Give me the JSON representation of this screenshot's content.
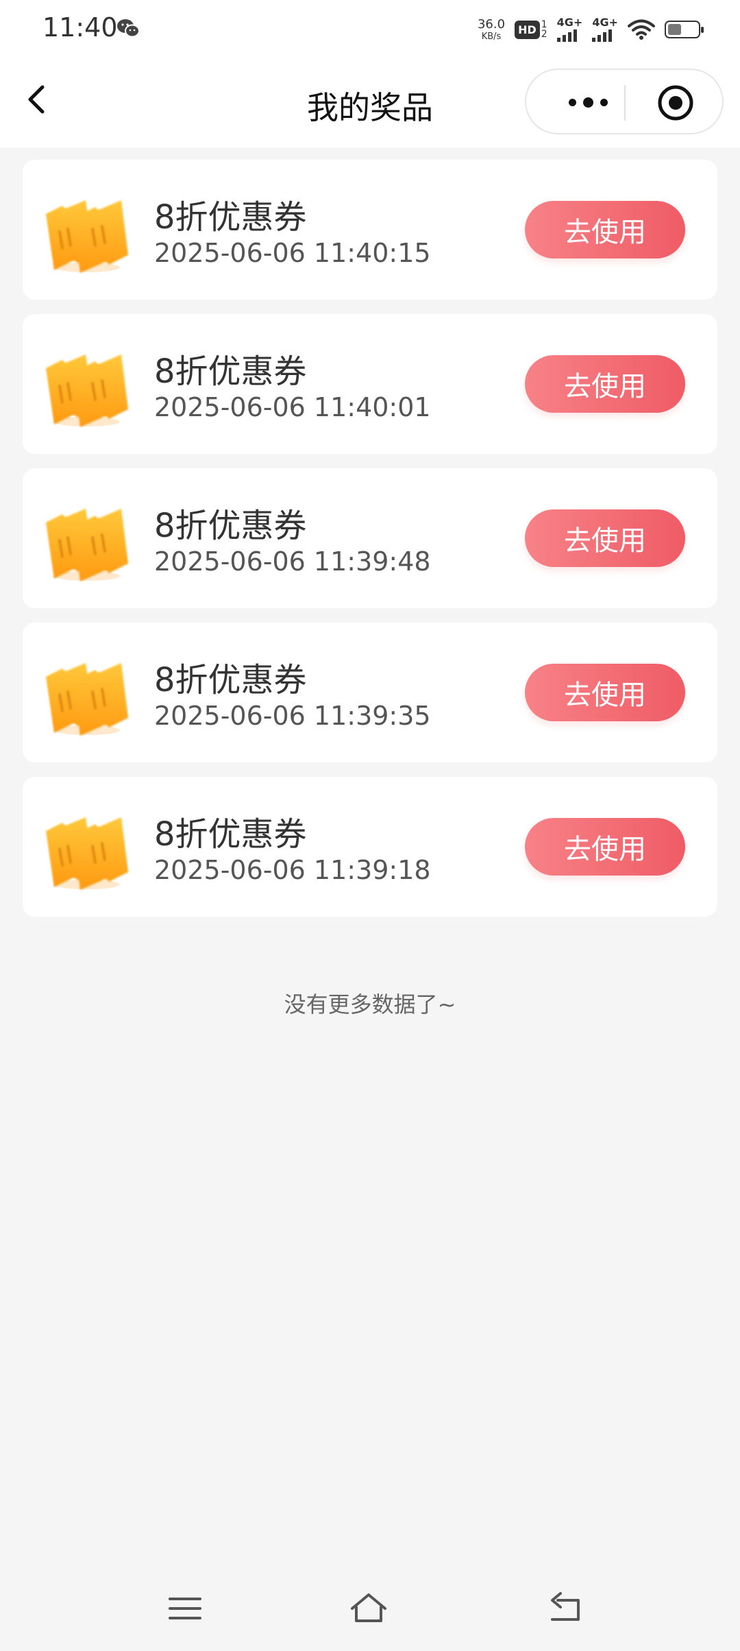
{
  "status_bar": {
    "time": "11:40",
    "net_speed": "36.0",
    "net_unit": "KB/s",
    "hd_label": "HD",
    "hd_sub_top": "1",
    "hd_sub_bottom": "2",
    "sim1_label": "4G+",
    "sim2_label": "4G+",
    "battery_level": 0.45,
    "icons": [
      "wechat-icon",
      "hd-icon",
      "signal-icon",
      "signal-icon",
      "wifi-icon",
      "battery-icon"
    ]
  },
  "nav": {
    "title": "我的奖品",
    "back_icon": "chevron-left-icon",
    "more_icon": "more-dots-icon",
    "close_icon": "target-close-icon"
  },
  "prizes": [
    {
      "name": "8折优惠券",
      "time": "2025-06-06 11:40:15",
      "button": "去使用"
    },
    {
      "name": "8折优惠券",
      "time": "2025-06-06 11:40:01",
      "button": "去使用"
    },
    {
      "name": "8折优惠券",
      "time": "2025-06-06 11:39:48",
      "button": "去使用"
    },
    {
      "name": "8折优惠券",
      "time": "2025-06-06 11:39:35",
      "button": "去使用"
    },
    {
      "name": "8折优惠券",
      "time": "2025-06-06 11:39:18",
      "button": "去使用"
    }
  ],
  "footer_text": "没有更多数据了~",
  "bottom_nav": {
    "icons": [
      "menu-icon",
      "home-icon",
      "back-icon"
    ]
  },
  "colors": {
    "button_start": "#f78287",
    "button_end": "#ef5c66",
    "ticket": "#ffb21f",
    "background": "#f5f5f5"
  }
}
